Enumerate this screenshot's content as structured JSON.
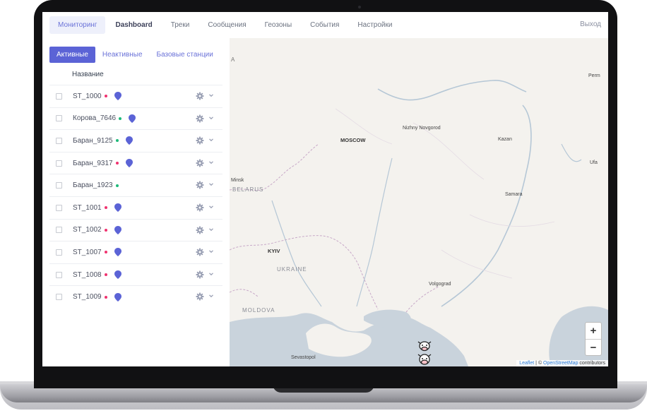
{
  "nav": {
    "items": [
      {
        "label": "Мониторинг",
        "active": true,
        "bold": false
      },
      {
        "label": "Dashboard",
        "active": false,
        "bold": true
      },
      {
        "label": "Треки",
        "active": false,
        "bold": false
      },
      {
        "label": "Сообщения",
        "active": false,
        "bold": false
      },
      {
        "label": "Геозоны",
        "active": false,
        "bold": false
      },
      {
        "label": "События",
        "active": false,
        "bold": false
      },
      {
        "label": "Настройки",
        "active": false,
        "bold": false
      }
    ],
    "logout_label": "Выход"
  },
  "tabs": [
    {
      "label": "Активные",
      "active": true
    },
    {
      "label": "Неактивные",
      "active": false
    },
    {
      "label": "Базовые станции",
      "active": false
    }
  ],
  "table": {
    "header": "Название",
    "rows": [
      {
        "name": "ST_1000",
        "status": "red",
        "pin": true
      },
      {
        "name": "Корова_7646",
        "status": "green",
        "pin": true
      },
      {
        "name": "Баран_9125",
        "status": "green",
        "pin": true
      },
      {
        "name": "Баран_9317",
        "status": "red",
        "pin": true
      },
      {
        "name": "Баран_1923",
        "status": "green",
        "pin": false
      },
      {
        "name": "ST_1001",
        "status": "red",
        "pin": true
      },
      {
        "name": "ST_1002",
        "status": "red",
        "pin": true
      },
      {
        "name": "ST_1007",
        "status": "red",
        "pin": true
      },
      {
        "name": "ST_1008",
        "status": "red",
        "pin": true
      },
      {
        "name": "ST_1009",
        "status": "red",
        "pin": true
      }
    ]
  },
  "colors": {
    "accent": "#5b63d6",
    "status_red": "#f0326f",
    "status_green": "#1fb97a",
    "pin": "#5b63d6"
  },
  "map": {
    "edge_letter": "А",
    "labels": {
      "perm": "Perm",
      "nizhny": "Nizhny Novgorod",
      "kazan": "Kazan",
      "moscow": "MOSCOW",
      "ufa": "Ufa",
      "minsk": "Minsk",
      "belarus": "BELARUS",
      "samara": "Samara",
      "kyiv": "KYIV",
      "ukraine": "UKRAINE",
      "volgograd": "Volgograd",
      "moldova": "MOLDOVA",
      "sevastopol": "Sevastopol"
    },
    "zoom_in": "+",
    "zoom_out": "−",
    "attribution": {
      "leaflet": "Leaflet",
      "sep": " | © ",
      "osm": "OpenStreetMap",
      "contrib": " contributors"
    }
  }
}
